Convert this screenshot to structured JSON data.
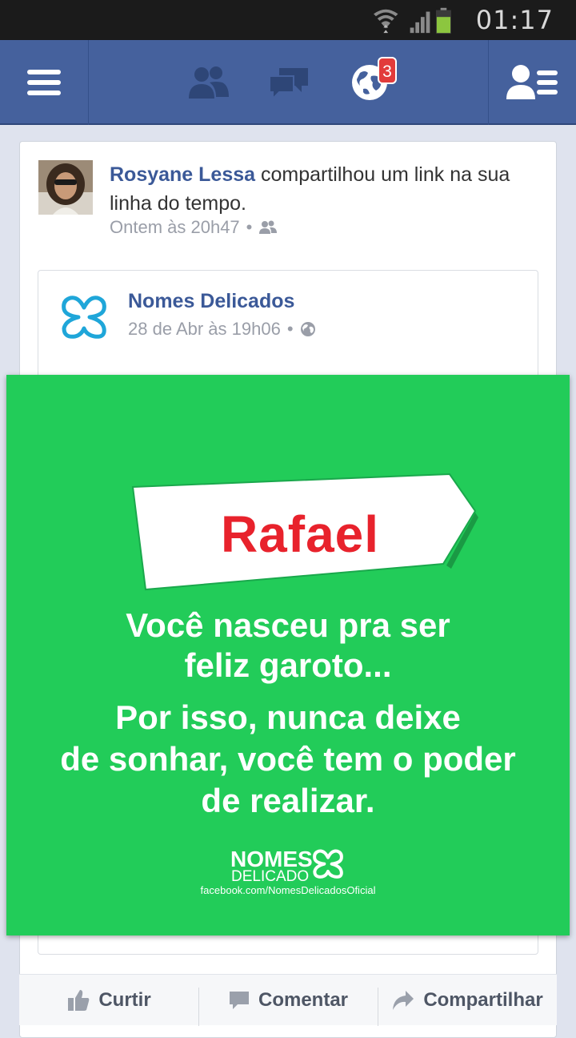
{
  "status_bar": {
    "time": "01:17"
  },
  "navbar": {
    "icons": [
      "menu-icon",
      "friends-icon",
      "messages-icon",
      "notifications-globe-icon",
      "contacts-icon"
    ],
    "notifications_badge": "3",
    "colors": {
      "bar": "#45619d",
      "badge": "#e23b3b"
    }
  },
  "story": {
    "author": "Rosyane Lessa",
    "action_text": " compartilhou um link na sua linha do tempo.",
    "timestamp": "Ontem às 20h47",
    "separator": "•",
    "privacy_icon": "friends-audience-icon"
  },
  "shared_post": {
    "page_name": "Nomes Delicados",
    "timestamp": "28 de Abr às 19h06",
    "separator": "•",
    "privacy_icon": "public-globe-icon",
    "image": {
      "name": "Rafael",
      "line1": "Você nasceu pra ser",
      "line2": "feliz garoto...",
      "line3": "Por isso, nunca deixe",
      "line4": "de sonhar, você tem o poder",
      "line5": "de realizar.",
      "brand_nome": "NOMES",
      "brand_delicados": "DELICADO",
      "brand_url": "facebook.com/NomesDelicadosOficial",
      "background_color": "#22cc59",
      "name_color": "#e8222c"
    }
  },
  "actions": {
    "like": "Curtir",
    "comment": "Comentar",
    "share": "Compartilhar"
  }
}
